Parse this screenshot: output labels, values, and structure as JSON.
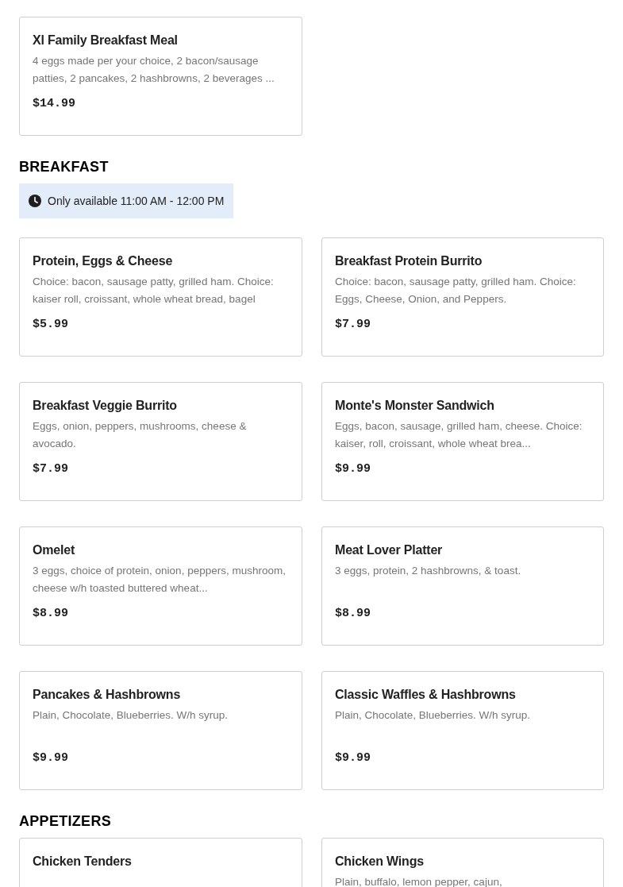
{
  "sections": [
    {
      "items": [
        {
          "name": "Xl Family Breakfast Meal",
          "description": "4 eggs made per your choice, 2 bacon/sausage patties, 2 pancakes, 2 hashbrowns, 2 beverages ...",
          "price": "$14.99"
        }
      ]
    },
    {
      "heading": "BREAKFAST",
      "notice": "Only available 11:00 AM - 12:00 PM",
      "items": [
        {
          "name": "Protein, Eggs & Cheese",
          "description": "Choice: bacon, sausage patty, grilled ham. Choice: kaiser roll, croissant, whole wheat bread, bagel",
          "price": "$5.99"
        },
        {
          "name": "Breakfast Protein Burrito",
          "description": "Choice: bacon, sausage patty, grilled ham. Choice: Eggs, Cheese, Onion, and Peppers.",
          "price": "$7.99"
        },
        {
          "name": "Breakfast Veggie Burrito",
          "description": "Eggs, onion, peppers, mushrooms, cheese & avocado.",
          "price": "$7.99"
        },
        {
          "name": "Monte's Monster Sandwich",
          "description": "Eggs, bacon, sausage, grilled ham, cheese. Choice: kaiser, roll, croissant, whole wheat brea...",
          "price": "$9.99"
        },
        {
          "name": "Omelet",
          "description": "3 eggs, choice of protein, onion, peppers, mushroom, cheese w/h toasted buttered wheat...",
          "price": "$8.99"
        },
        {
          "name": "Meat Lover Platter",
          "description": "3 eggs, protein, 2 hashbrowns, & toast.",
          "price": "$8.99"
        },
        {
          "name": "Pancakes & Hashbrowns",
          "description": "Plain, Chocolate, Blueberries. W/h syrup.",
          "price": "$9.99"
        },
        {
          "name": "Classic Waffles & Hashbrowns",
          "description": "Plain, Chocolate, Blueberries. W/h syrup.",
          "price": "$9.99"
        }
      ]
    },
    {
      "heading": "APPETIZERS",
      "items": [
        {
          "name": "Chicken Tenders"
        },
        {
          "name": "Chicken Wings",
          "description": "Plain, buffalo, lemon pepper, cajun,"
        }
      ]
    }
  ]
}
